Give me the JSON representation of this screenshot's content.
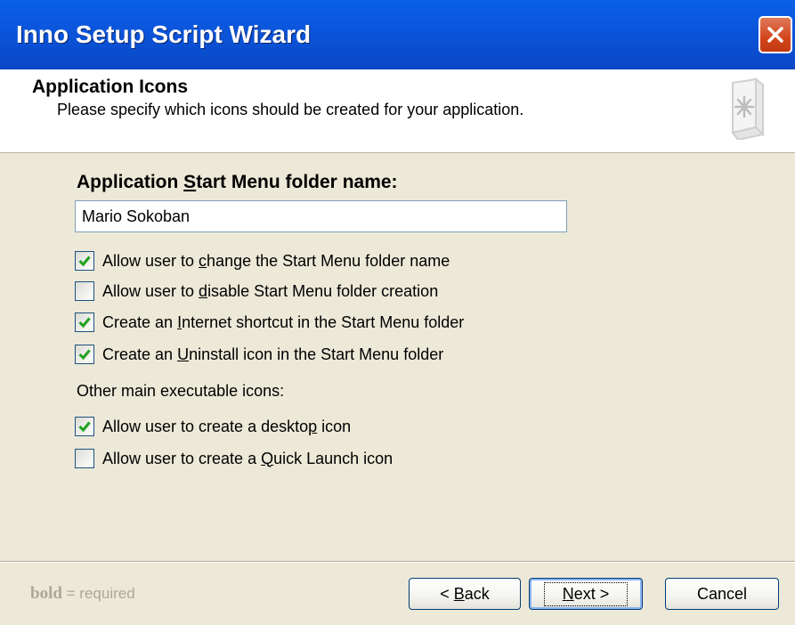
{
  "window": {
    "title": "Inno Setup Script Wizard",
    "close_icon": "close-icon"
  },
  "header": {
    "title": "Application Icons",
    "subtitle": "Please specify which icons should be created for your application.",
    "icon": "wizard-page-icon"
  },
  "start_menu": {
    "label_prefix": "Application ",
    "label_accel": "S",
    "label_suffix": "tart Menu folder name:",
    "folder_name": "Mario Sokoban"
  },
  "options": [
    {
      "prefix": "Allow user to ",
      "accel": "c",
      "suffix": "hange the Start Menu folder name",
      "checked": true
    },
    {
      "prefix": "Allow user to ",
      "accel": "d",
      "suffix": "isable Start Menu folder creation",
      "checked": false
    },
    {
      "prefix": "Create an ",
      "accel": "I",
      "suffix": "nternet shortcut in the Start Menu folder",
      "checked": true
    },
    {
      "prefix": "Create an ",
      "accel": "U",
      "suffix": "ninstall icon in the Start Menu folder",
      "checked": true
    }
  ],
  "other_label": "Other main executable icons:",
  "other_options": [
    {
      "prefix": "Allow user to create a deskto",
      "accel": "p",
      "suffix": " icon",
      "checked": true
    },
    {
      "prefix": "Allow user to create a ",
      "accel": "Q",
      "suffix": "uick Launch icon",
      "checked": false
    }
  ],
  "footer": {
    "required_bold": "bold",
    "required_text": " = required",
    "back_prefix": "< ",
    "back_accel": "B",
    "back_suffix": "ack",
    "next_accel": "N",
    "next_suffix": "ext >",
    "cancel": "Cancel"
  },
  "colors": {
    "titlebar": "#0a56dc",
    "dialog_bg": "#ece9d8",
    "checkmark": "#21a121",
    "close_button": "#d2451b"
  }
}
